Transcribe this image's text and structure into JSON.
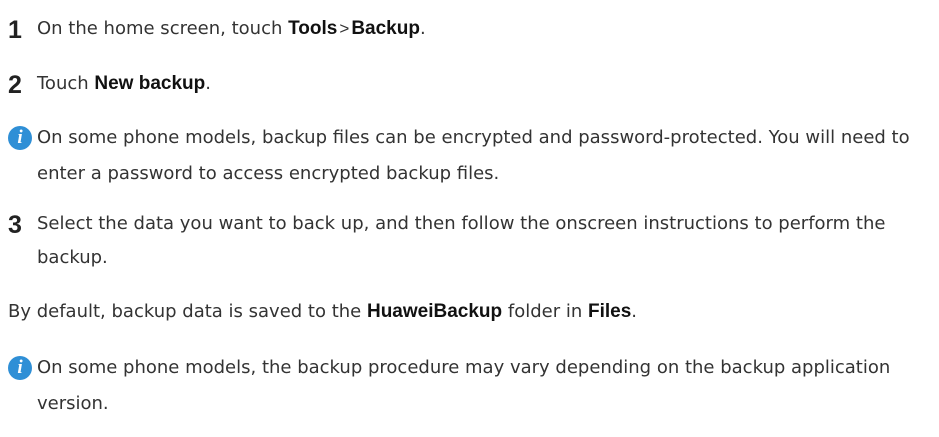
{
  "step1": {
    "number": "1",
    "text_before": "On the home screen, touch ",
    "tools": "Tools",
    "separator": ">",
    "backup": "Backup",
    "period": "."
  },
  "step2": {
    "number": "2",
    "text_before": "Touch ",
    "new_backup": "New backup",
    "period": "."
  },
  "note1": {
    "icon": "info-icon",
    "text": "On some phone models, backup files can be encrypted and password-protected. You will need to enter a password to access encrypted backup files."
  },
  "step3": {
    "number": "3",
    "text": "Select the data you want to back up, and then follow the onscreen instructions to perform the backup."
  },
  "default_para": {
    "text_before": "By default, backup data is saved to the ",
    "folder": "HuaweiBackup",
    "text_middle": " folder in ",
    "files": "Files",
    "period": "."
  },
  "note2": {
    "icon": "info-icon",
    "text": "On some phone models, the backup procedure may vary depending on the backup application version."
  },
  "colors": {
    "info_icon": "#2f8fd6",
    "text": "#333333"
  }
}
